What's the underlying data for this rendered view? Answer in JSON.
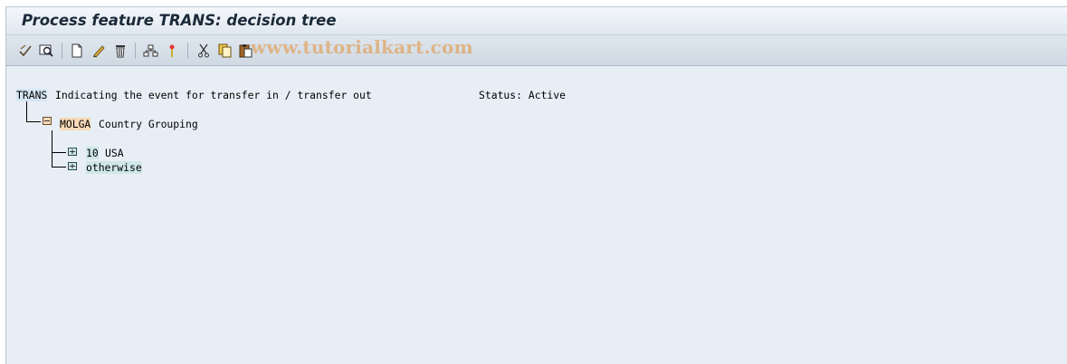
{
  "window": {
    "title": "Process feature TRANS: decision tree"
  },
  "toolbar": {
    "buttons": [
      "check-icon",
      "other-feature-icon",
      "create-icon",
      "change-icon",
      "delete-icon",
      "display-structure-icon",
      "navigate-icon",
      "cut-icon",
      "copy-icon",
      "paste-icon"
    ]
  },
  "watermark": "www.tutorialkart.com",
  "tree": {
    "root": {
      "key": "TRANS",
      "text": "Indicating the event for transfer in / transfer out",
      "status": "Status: Active"
    },
    "level1": {
      "key": "MOLGA",
      "text": "Country Grouping"
    },
    "level2": [
      {
        "key": "10",
        "text": "USA"
      },
      {
        "key": "otherwise",
        "text": ""
      }
    ]
  },
  "colors": {
    "background": "#e8eef5",
    "key_highlight": "#d6e6f3",
    "orange_highlight": "#f7d9b8",
    "teal_highlight": "#cfe7e8"
  }
}
